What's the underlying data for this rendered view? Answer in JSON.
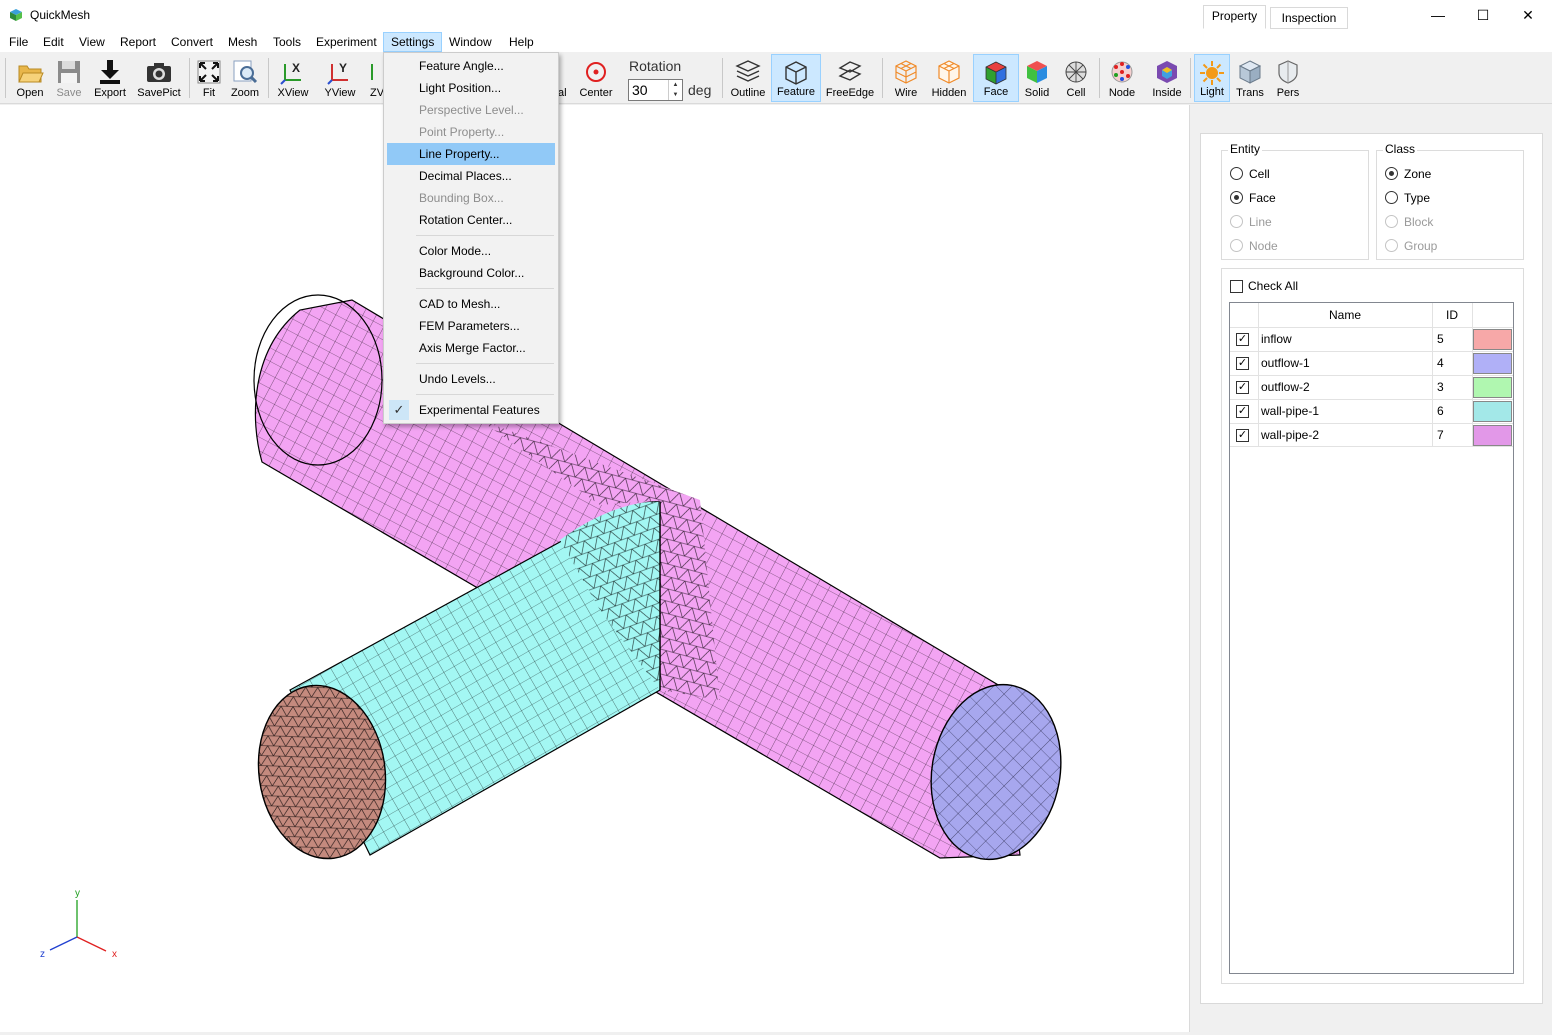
{
  "window": {
    "title": "QuickMesh",
    "minimize": "—",
    "maximize": "☐",
    "close": "✕"
  },
  "menubar": [
    "File",
    "Edit",
    "View",
    "Report",
    "Convert",
    "Mesh",
    "Tools",
    "Experiment",
    "Settings",
    "Window",
    "Help"
  ],
  "toolbar": {
    "open": "Open",
    "save": "Save",
    "export": "Export",
    "savepict": "SavePict",
    "fit": "Fit",
    "zoom": "Zoom",
    "xview": "XView",
    "yview": "YView",
    "zview_partial": "ZV",
    "normal_partial": "al",
    "center": "Center",
    "rotation_label": "Rotation",
    "rotation_value": "30",
    "rotation_unit": "deg",
    "outline": "Outline",
    "feature": "Feature",
    "freeedge": "FreeEdge",
    "wire": "Wire",
    "hidden": "Hidden",
    "face": "Face",
    "solid": "Solid",
    "cell": "Cell",
    "node": "Node",
    "inside": "Inside",
    "light": "Light",
    "trans": "Trans",
    "pers": "Pers"
  },
  "settings_menu": {
    "items": [
      "Feature Angle...",
      "Light Position...",
      "Perspective Level...",
      "Point Property...",
      "Line Property...",
      "Decimal Places...",
      "Bounding Box...",
      "Rotation Center...",
      "Color Mode...",
      "Background Color...",
      "CAD to Mesh...",
      "FEM Parameters...",
      "Axis Merge Factor...",
      "Undo Levels...",
      "Experimental Features"
    ],
    "check_mark": "✓"
  },
  "panel": {
    "tabs": [
      "Property",
      "Inspection"
    ],
    "entity": {
      "title": "Entity",
      "options": [
        "Cell",
        "Face",
        "Line",
        "Node"
      ],
      "selected": "Face"
    },
    "class": {
      "title": "Class",
      "options": [
        "Zone",
        "Type",
        "Block",
        "Group"
      ],
      "selected": "Zone"
    },
    "check_all": "Check All",
    "columns": [
      "Name",
      "ID"
    ],
    "rows": [
      {
        "name": "inflow",
        "id": "5",
        "color": "#f7a8a8"
      },
      {
        "name": "outflow-1",
        "id": "4",
        "color": "#b0b0f7"
      },
      {
        "name": "outflow-2",
        "id": "3",
        "color": "#b0f7b0"
      },
      {
        "name": "wall-pipe-1",
        "id": "6",
        "color": "#a3e8e8"
      },
      {
        "name": "wall-pipe-2",
        "id": "7",
        "color": "#e298e8"
      }
    ],
    "check_mark": "✓"
  },
  "axes": {
    "x": "x",
    "y": "y",
    "z": "z"
  },
  "colors": {
    "pink_pipe": "#f3a4f3",
    "cyan_pipe": "#a3f7f3",
    "inlet_face": "#c48a7e",
    "outlet_face": "#a7a7ee",
    "accent": "#cce8ff"
  }
}
